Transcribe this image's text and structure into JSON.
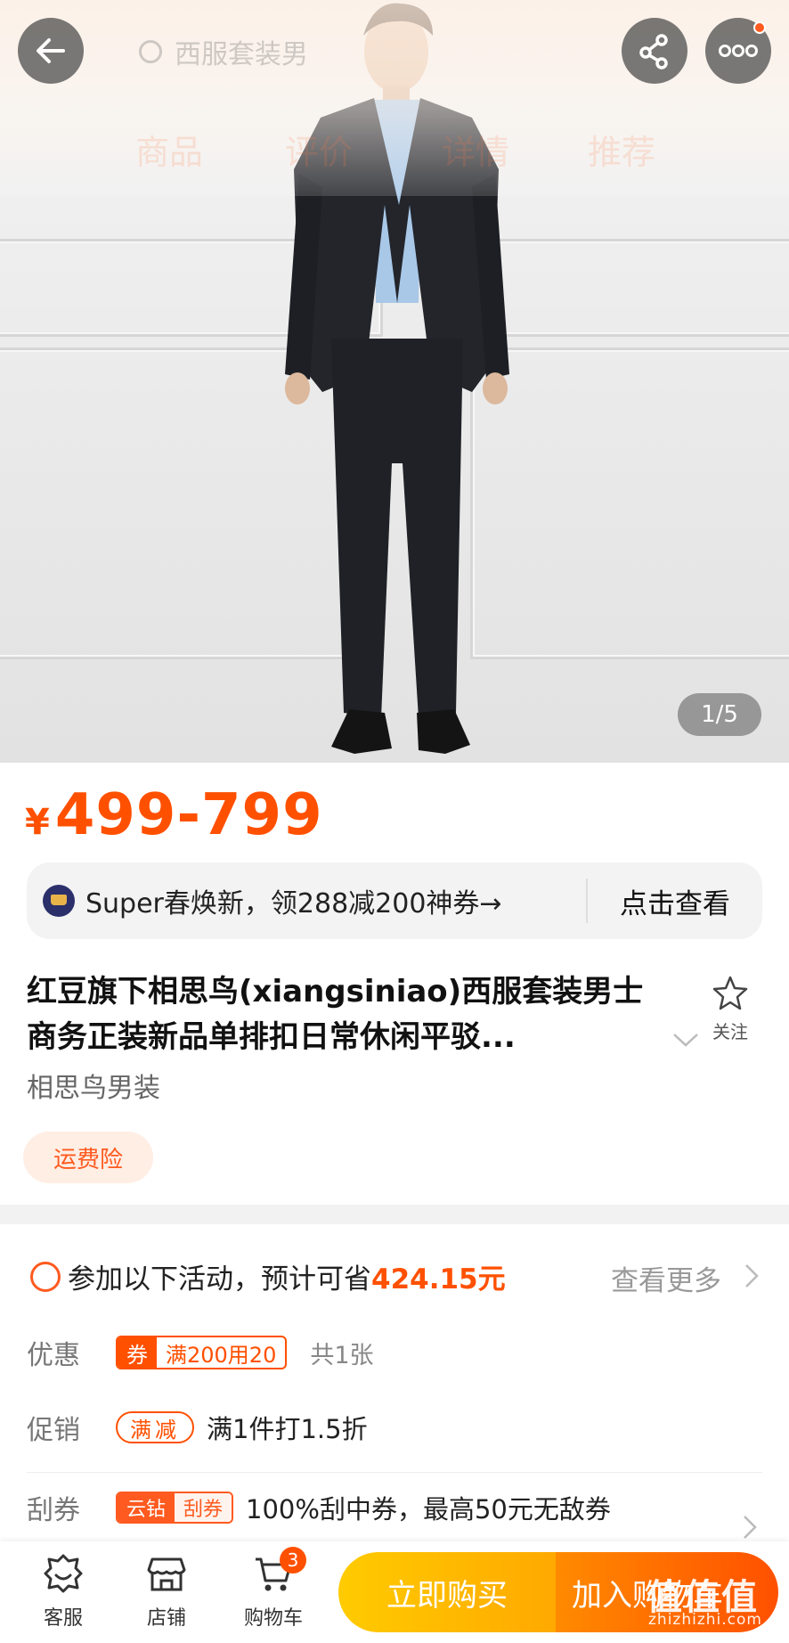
{
  "header": {
    "search_placeholder": "西服套装男",
    "tabs": [
      "商品",
      "评价",
      "详情",
      "推荐"
    ],
    "back_icon": "arrow-left-icon",
    "share_icon": "share-icon",
    "more_icon": "more-icon"
  },
  "gallery": {
    "counter": "1/5"
  },
  "price": {
    "symbol": "¥",
    "range": "499-799"
  },
  "promo_banner": {
    "text": "Super春焕新，领288减200神券→",
    "action": "点击查看"
  },
  "product": {
    "title": "红豆旗下相思鸟(xiangsiniao)西服套装男士商务正装新品单排扣日常休闲平驳...",
    "favorite_label": "关注",
    "shop_name": "相思鸟男装",
    "tag": "运费险"
  },
  "activities": {
    "lead": "参加以下活动，预计可省",
    "amount": "424.15元",
    "more": "查看更多",
    "discount": {
      "key": "优惠",
      "coupon_tag": "券",
      "coupon_text": "满200用20",
      "count": "共1张"
    },
    "promotion": {
      "key": "促销",
      "tag": "满减",
      "text": "满1件打1.5折"
    },
    "scratch": {
      "key": "刮券",
      "tag_a": "云钻",
      "tag_b": "刮券",
      "text": "100%刮中券，最高50元无敌券"
    }
  },
  "bottom_bar": {
    "service": "客服",
    "store": "店铺",
    "cart": "购物车",
    "cart_count": "3",
    "buy_now": "立即购买",
    "add_to_cart": "加入购物车"
  },
  "watermark": {
    "text": "值值值",
    "url": "zhizhizhi.com"
  },
  "colors": {
    "accent": "#ff5000",
    "buy_yellow": "#ffb800",
    "cart_orange": "#ff6a00"
  }
}
